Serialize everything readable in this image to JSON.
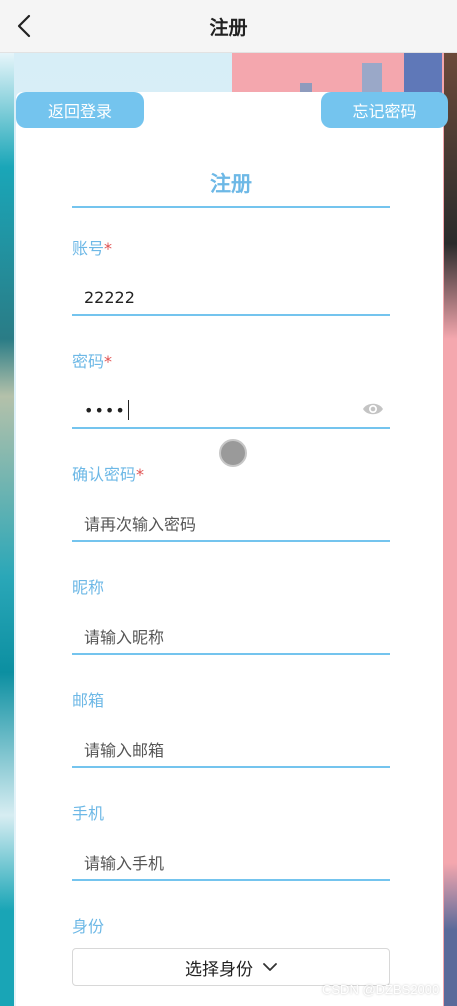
{
  "nav": {
    "title": "注册"
  },
  "buttons": {
    "back_login": "返回登录",
    "forgot_password": "忘记密码"
  },
  "form": {
    "title": "注册",
    "required_mark": "*",
    "account": {
      "label": "账号",
      "value": "22222"
    },
    "password": {
      "label": "密码",
      "masked_value": "••••"
    },
    "confirm_password": {
      "label": "确认密码",
      "placeholder": "请再次输入密码"
    },
    "nickname": {
      "label": "昵称",
      "placeholder": "请输入昵称"
    },
    "email": {
      "label": "邮箱",
      "placeholder": "请输入邮箱"
    },
    "phone": {
      "label": "手机",
      "placeholder": "请输入手机"
    },
    "identity": {
      "label": "身份",
      "select_text": "选择身份"
    }
  },
  "watermark": "CSDN @DZBS2000",
  "colors": {
    "accent": "#74c4ee",
    "label": "#6db8e6",
    "required": "#e05050"
  }
}
